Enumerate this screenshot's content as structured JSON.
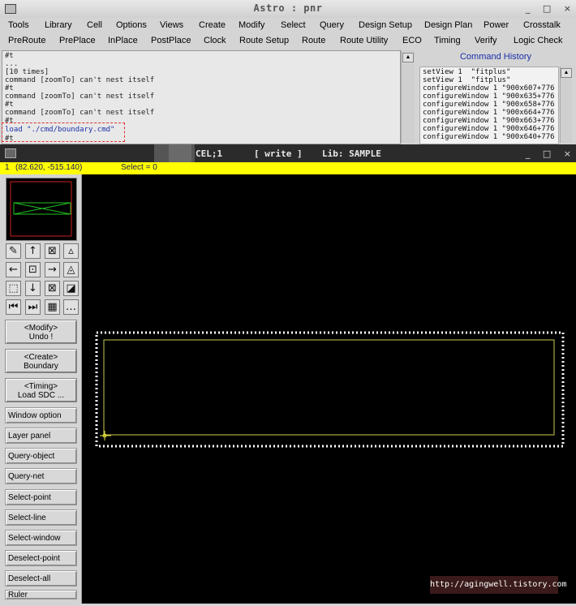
{
  "app_title": "Astro : pnr",
  "window_buttons": [
    "_",
    "□",
    "×"
  ],
  "menu_row1": [
    "Tools",
    "Library",
    "Cell",
    "Options",
    "Views",
    "Create",
    "Modify",
    "Select",
    "Query",
    "Design Setup",
    "Design Plan",
    "Power",
    "Crosstalk"
  ],
  "menu_row2": [
    "PreRoute",
    "PrePlace",
    "InPlace",
    "PostPlace",
    "Clock",
    "Route Setup",
    "Route",
    "Route Utility",
    "ECO",
    "Timing",
    "Verify",
    "Logic Check"
  ],
  "console_lines": [
    "#t",
    "...",
    "[10 times]",
    "command [zoomTo] can't nest itself",
    "#t",
    "command [zoomTo] can't nest itself",
    "#t",
    "command [zoomTo] can't nest itself",
    "#t"
  ],
  "console_command": "load \"./cmd/boundary.cmd\"",
  "console_last": "#t",
  "history": {
    "title": "Command History",
    "items": [
      "setView 1  \"fitplus\"",
      "setView 1  \"fitplus\"",
      "configureWindow 1 \"900x607+776",
      "configureWindow 1 \"900x635+776",
      "configureWindow 1 \"900x658+776",
      "configureWindow 1 \"900x664+776",
      "configureWindow 1 \"900x663+776",
      "configureWindow 1 \"900x646+776",
      "configureWindow 1 \"900x640+776"
    ]
  },
  "layout_window": {
    "cell": "CEL;1",
    "mode": "[ write ]",
    "lib": "Lib: SAMPLE"
  },
  "status": {
    "window_id": "1",
    "coords": "(82.620, -515.140)",
    "select": "Select = 0"
  },
  "toolbar_icons": [
    "edit-icon",
    "arrow-up-icon",
    "fit-icon",
    "zoom-small-icon",
    "arrow-left-icon",
    "zoom-center-icon",
    "arrow-right-icon",
    "zoom-in-icon",
    "zoom-prev-icon",
    "arrow-down-icon",
    "zoom-box-icon",
    "zoom-out-icon",
    "rewind-icon",
    "fast-forward-icon",
    "grid-icon",
    "more-icon"
  ],
  "toolbar_glyphs": [
    "✎",
    "↑",
    "⊠",
    "▵",
    "←",
    "⊡",
    "→",
    "◬",
    "⬚",
    "↓",
    "⊠",
    "◪",
    "⏮",
    "⏭",
    "▦",
    "…"
  ],
  "big_buttons": [
    {
      "line1": "<Modify>",
      "line2": "Undo !"
    },
    {
      "line1": "<Create>",
      "line2": "Boundary"
    },
    {
      "line1": "<Timing>",
      "line2": "Load SDC ..."
    }
  ],
  "side_buttons": [
    "Window option",
    "Layer panel",
    "Query-object",
    "Query-net",
    "Select-point",
    "Select-line",
    "Select-window",
    "Deselect-point",
    "Deselect-all",
    "Ruler"
  ],
  "watermark": "http://agingwell.tistory.com",
  "colors": {
    "status_bar": "#ffff00",
    "boundary": "#c8c850",
    "selection": "#ffffff",
    "overview_red": "#cc2020",
    "overview_green": "#20c020"
  }
}
